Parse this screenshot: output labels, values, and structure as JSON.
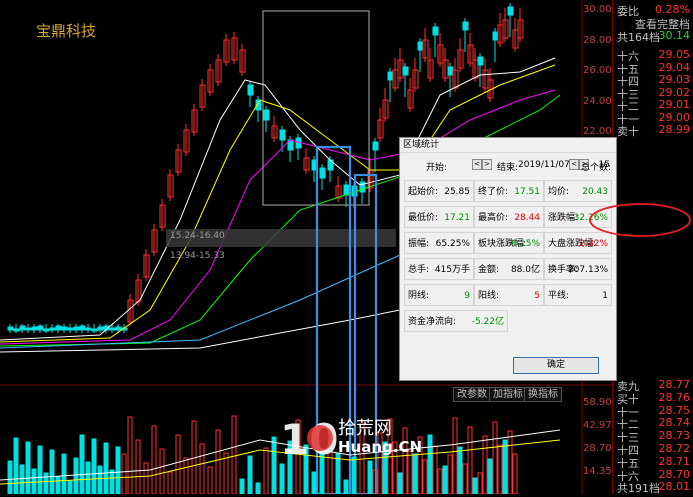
{
  "stock_name": "宝鼎科技",
  "price_axis": [
    "30.00",
    "28.00",
    "26.00",
    "24.00",
    "22.00"
  ],
  "volume_axis": [
    "58.90",
    "42.97",
    "28.70",
    "14.35"
  ],
  "chart_annotations": {
    "level_box": "15.24-16.40",
    "level_box_low": "13.94-15.33"
  },
  "toolbar": {
    "btn1": "改参数",
    "btn2": "加指标",
    "btn3": "换指标"
  },
  "right_panel": {
    "top": [
      {
        "label": "委比",
        "value": "0.28%",
        "color": "#ff3030"
      },
      {
        "label": "",
        "value": "查看完整档",
        "color": "#c0c0c0"
      },
      {
        "label": "共164档",
        "value": "30.14",
        "color": "#30d030"
      }
    ],
    "sell_levels": [
      {
        "label": "十六",
        "value": "29.05"
      },
      {
        "label": "十五",
        "value": "29.04"
      },
      {
        "label": "十四",
        "value": "29.03"
      },
      {
        "label": "十三",
        "value": "29.02"
      },
      {
        "label": "十二",
        "value": "29.01"
      },
      {
        "label": "十一",
        "value": "29.00"
      },
      {
        "label": "卖十",
        "value": "28.99"
      }
    ],
    "buy_levels": [
      {
        "label": "卖九",
        "value": "28.77"
      },
      {
        "label": "买十",
        "value": "28.76"
      },
      {
        "label": "十一",
        "value": "28.75"
      },
      {
        "label": "十二",
        "value": "28.74"
      },
      {
        "label": "十三",
        "value": "28.73"
      },
      {
        "label": "十四",
        "value": "28.72"
      },
      {
        "label": "十五",
        "value": "28.71"
      },
      {
        "label": "十六",
        "value": "28.70"
      },
      {
        "label": "共191档",
        "value": "28.01"
      }
    ]
  },
  "dialog": {
    "title": "区域统计",
    "start_label": "开始:",
    "end_label": "结束:",
    "end_date": "2019/11/07",
    "periods_label": "总个数:",
    "periods": "15",
    "rows": [
      [
        {
          "k": "起始价:",
          "v": "25.85",
          "c": "blk"
        },
        {
          "k": "终了价:",
          "v": "17.51",
          "c": "green"
        },
        {
          "k": "均价:",
          "v": "20.43",
          "c": "green"
        }
      ],
      [
        {
          "k": "最低价:",
          "v": "17.21",
          "c": "green"
        },
        {
          "k": "最高价:",
          "v": "28.44",
          "c": "red"
        },
        {
          "k": "涨跌幅:",
          "v": "-32.26%",
          "c": "green"
        }
      ],
      [
        {
          "k": "振幅:",
          "v": "65.25%",
          "c": "blk"
        },
        {
          "k": "板块涨跌幅:",
          "v": "-6.15%",
          "c": "green"
        },
        {
          "k": "大盘涨跌幅:",
          "v": "2.82%",
          "c": "red"
        }
      ],
      [
        {
          "k": "总手:",
          "v": "415万手",
          "c": "blk"
        },
        {
          "k": "金额:",
          "v": "88.0亿",
          "c": "blk"
        },
        {
          "k": "换手率:",
          "v": "207.13%",
          "c": "blk"
        }
      ],
      [
        {
          "k": "阴线:",
          "v": "9",
          "c": "green"
        },
        {
          "k": "阳线:",
          "v": "5",
          "c": "red"
        },
        {
          "k": "平线:",
          "v": "1",
          "c": "blk"
        }
      ],
      [
        {
          "k": "资金净流向:",
          "v": "-5.22亿",
          "c": "green"
        }
      ]
    ],
    "ok_label": "确定"
  },
  "watermark": {
    "big": "10",
    "cn": "拾荒网",
    "site": "Huang.CN"
  },
  "colors": {
    "up": "#ff3030",
    "down": "#00e0e0",
    "ma5": "#ffffff",
    "ma10": "#ffff00",
    "ma20": "#ff00ff",
    "ma60": "#00ff00",
    "highlight": "#3b8fe0"
  }
}
